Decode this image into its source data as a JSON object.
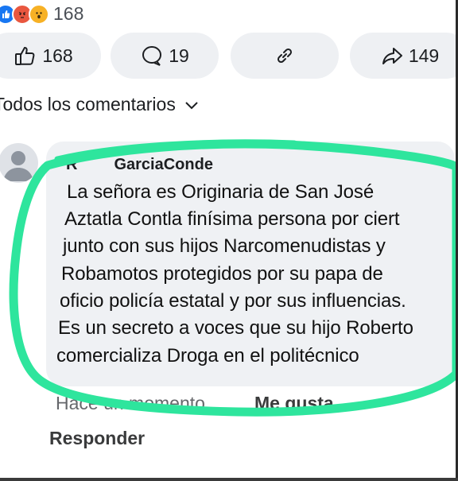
{
  "reactions": {
    "icons": [
      "like-icon",
      "angry-icon",
      "wow-icon"
    ],
    "count": "168"
  },
  "actions": {
    "like_count": "168",
    "comment_count": "19",
    "share_count": "149"
  },
  "comments_filter": {
    "label": "Todos los comentarios"
  },
  "comment": {
    "author": "GarciaConde",
    "author_prefix_visible": "R",
    "lines": [
      "La señora es Originaria de San José",
      "Aztatla Contla finísima persona por ciert",
      "junto con sus hijos Narcomenudistas y",
      "Robamotos protegidos por su papa de",
      "oficio policía estatal y por sus influencias.",
      "Es un secreto a voces que su hijo Roberto",
      "comercializa Droga en el politécnico"
    ],
    "time": "Hace un momento",
    "like_label": "Me gusta",
    "reply_label": "Responder"
  },
  "colors": {
    "highlight": "#2ee59d",
    "bubble": "#eff1f4",
    "like_blue": "#1877f2"
  }
}
